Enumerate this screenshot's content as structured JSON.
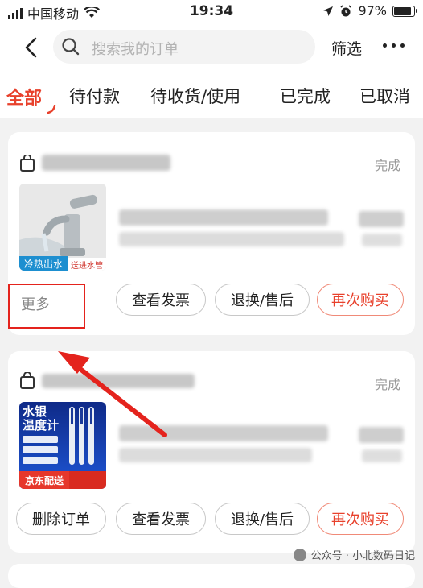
{
  "status_bar": {
    "carrier": "中国移动",
    "time": "19:34",
    "battery": "97%",
    "battery_level": 0.97
  },
  "header": {
    "search_placeholder": "搜索我的订单",
    "filter_label": "筛选"
  },
  "tabs": [
    {
      "label": "全部",
      "active": true
    },
    {
      "label": "待付款",
      "active": false
    },
    {
      "label": "待收货/使用",
      "active": false
    },
    {
      "label": "已完成",
      "active": false
    },
    {
      "label": "已取消",
      "active": false
    }
  ],
  "orders": [
    {
      "status": "完成",
      "image_tags": [
        "冷热出水",
        "送进水管"
      ],
      "more_label": "更多",
      "buttons": [
        "查看发票",
        "退换/售后",
        "再次购买"
      ]
    },
    {
      "status": "完成",
      "image_title": [
        "水银",
        "温度计"
      ],
      "image_bar": "京东配送",
      "buttons": [
        "删除订单",
        "查看发票",
        "退换/售后",
        "再次购买"
      ]
    }
  ],
  "watermark": "公众号 · 小北数码日记",
  "colors": {
    "accent": "#e8412c",
    "highlight": "#e4231d"
  }
}
